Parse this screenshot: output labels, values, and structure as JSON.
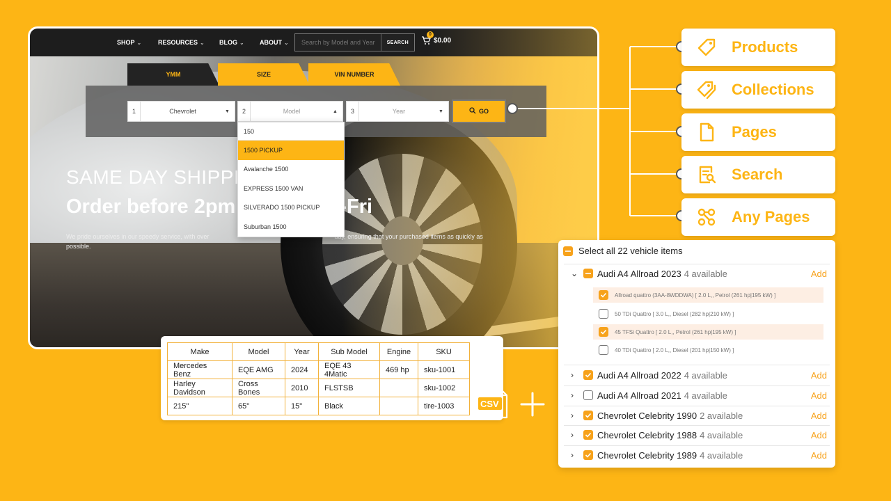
{
  "store": {
    "nav": [
      {
        "label": "SHOP"
      },
      {
        "label": "RESOURCES"
      },
      {
        "label": "BLOG"
      },
      {
        "label": "ABOUT"
      }
    ],
    "search_placeholder": "Search by Model and Year",
    "search_button": "SEARCH",
    "cart_count": "0",
    "cart_total": "$0.00",
    "tabs": [
      "YMM",
      "SIZE",
      "VIN NUMBER"
    ],
    "selects": [
      {
        "num": "1",
        "value": "Chevrolet"
      },
      {
        "num": "2",
        "value": "Model"
      },
      {
        "num": "3",
        "value": "Year"
      }
    ],
    "go_label": "GO",
    "dropdown": {
      "query": "150",
      "items": [
        "1500 PICKUP",
        "Avalanche 1500",
        "EXPRESS 1500 VAN",
        "SILVERADO 1500 PICKUP",
        "Suburban 1500"
      ],
      "highlighted_index": 0
    },
    "hero": {
      "line1": "SAME DAY SHIPPI",
      "line2": "Order before 2pm",
      "line2_tail": "-Fri",
      "text": "We pride ourselves in our speedy service, with over",
      "text_mid": "day, ensuring that your purchased items as quickly as",
      "text_end": "possible."
    }
  },
  "features": [
    {
      "label": "Products",
      "icon": "tag-icon"
    },
    {
      "label": "Collections",
      "icon": "tags-icon"
    },
    {
      "label": "Pages",
      "icon": "page-icon"
    },
    {
      "label": "Search",
      "icon": "search-doc-icon"
    },
    {
      "label": "Any Pages",
      "icon": "nodes-icon"
    }
  ],
  "vehicles": {
    "select_all": "Select all 22 vehicle items",
    "add_label": "Add",
    "groups": [
      {
        "name": "Audi A4 Allroad 2023",
        "available": "4 available",
        "state": "partial",
        "expanded": true,
        "items": [
          {
            "label": "Allroad quattro (3AA-8WDDWA) [ 2.0 L,, Petrol (261 hp|195 kW) ]",
            "checked": true
          },
          {
            "label": "50 TDi Quattro [ 3.0 L,, Diesel (282 hp|210 kW) ]",
            "checked": false
          },
          {
            "label": "45 TFSi Quattro [ 2.0 L,, Petrol (261 hp|195 kW) ]",
            "checked": true
          },
          {
            "label": "40 TDi Quattro [ 2.0 L,, Diesel (201 hp|150 kW) ]",
            "checked": false
          }
        ]
      },
      {
        "name": "Audi A4 Allroad 2022",
        "available": "4 available",
        "state": "checked",
        "expanded": false
      },
      {
        "name": "Audi A4 Allroad 2021",
        "available": "4 available",
        "state": "empty",
        "expanded": false
      },
      {
        "name": "Chevrolet Celebrity 1990",
        "available": "2 available",
        "state": "checked",
        "expanded": false
      },
      {
        "name": "Chevrolet Celebrity 1988",
        "available": "4 available",
        "state": "checked",
        "expanded": false
      },
      {
        "name": "Chevrolet Celebrity 1989",
        "available": "4 available",
        "state": "checked",
        "expanded": false
      }
    ]
  },
  "table": {
    "headers": [
      "Make",
      "Model",
      "Year",
      "Sub Model",
      "Engine",
      "SKU"
    ],
    "rows": [
      [
        "Mercedes Benz",
        "EQE AMG",
        "2024",
        "EQE 43 4Matic",
        "469 hp",
        "sku-1001"
      ],
      [
        "Harley Davidson",
        "Cross Bones",
        "2010",
        "FLSTSB",
        "",
        "sku-1002"
      ],
      [
        "215\"",
        "65\"",
        "15\"",
        "Black",
        "",
        "tire-1003"
      ]
    ]
  },
  "csv_label": "CSV",
  "colors": {
    "accent": "#fdb515",
    "check": "#f7a21b",
    "dark": "#1d1d1d"
  }
}
